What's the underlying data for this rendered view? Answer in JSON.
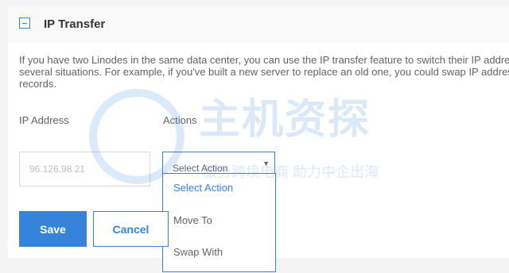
{
  "section": {
    "title": "IP Transfer",
    "description_lines": [
      "If you have two Linodes in the same data center, you can use the IP transfer feature to switch their IP addre",
      "several situations. For example, if you've built a new server to replace an old one, you could swap IP addres",
      "records."
    ]
  },
  "form": {
    "ip_label": "IP Address",
    "actions_label": "Actions",
    "ip_value": "96.126.98.21",
    "select_value": "Select Action",
    "options": [
      "Select Action",
      "Move To",
      "Swap With"
    ]
  },
  "buttons": {
    "save": "Save",
    "cancel": "Cancel"
  },
  "watermark": {
    "main": "主机资探",
    "sub": "服务跨境电商 助力中企出海"
  },
  "colors": {
    "accent": "#3683dc",
    "text": "#32363c",
    "muted": "#606469"
  }
}
